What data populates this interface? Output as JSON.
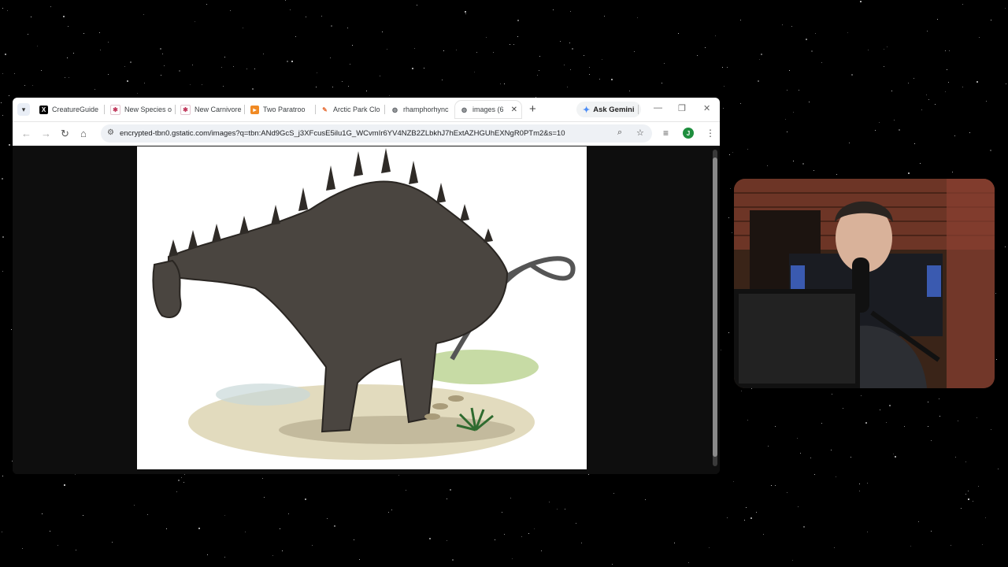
{
  "browser": {
    "tabs": [
      {
        "title": "CreatureGuide",
        "icon": "x-logo-icon",
        "color": "#000000"
      },
      {
        "title": "New Species o",
        "icon": "asterisk-logo-icon",
        "color": "#c0365a"
      },
      {
        "title": "New Carnivore",
        "icon": "asterisk-logo-icon",
        "color": "#c0365a"
      },
      {
        "title": "Two Paratroo",
        "icon": "orange-square-icon",
        "color": "#f08a24"
      },
      {
        "title": "Arctic Park Clo",
        "icon": "pencil-icon",
        "color": "#e8703a"
      },
      {
        "title": "rhamphorhync",
        "icon": "globe-icon",
        "color": "#5f6368"
      },
      {
        "title": "images (6",
        "icon": "globe-icon",
        "color": "#5f6368",
        "active": true
      }
    ],
    "ask_gemini": "Ask Gemini",
    "url": "encrypted-tbn0.gstatic.com/images?q=tbn:ANd9GcS_j3XFcusE5ilu1G_WCvmIr6YV4NZB2ZLbkhJ7hExtAZHGUhEXNgR0PTm2&s=10",
    "profile_initial": "J"
  },
  "content": {
    "image_subject": "dinosaur illustration (long-necked sauropod with spiny back)"
  },
  "webcam": {
    "subject": "streamer with microphone"
  }
}
